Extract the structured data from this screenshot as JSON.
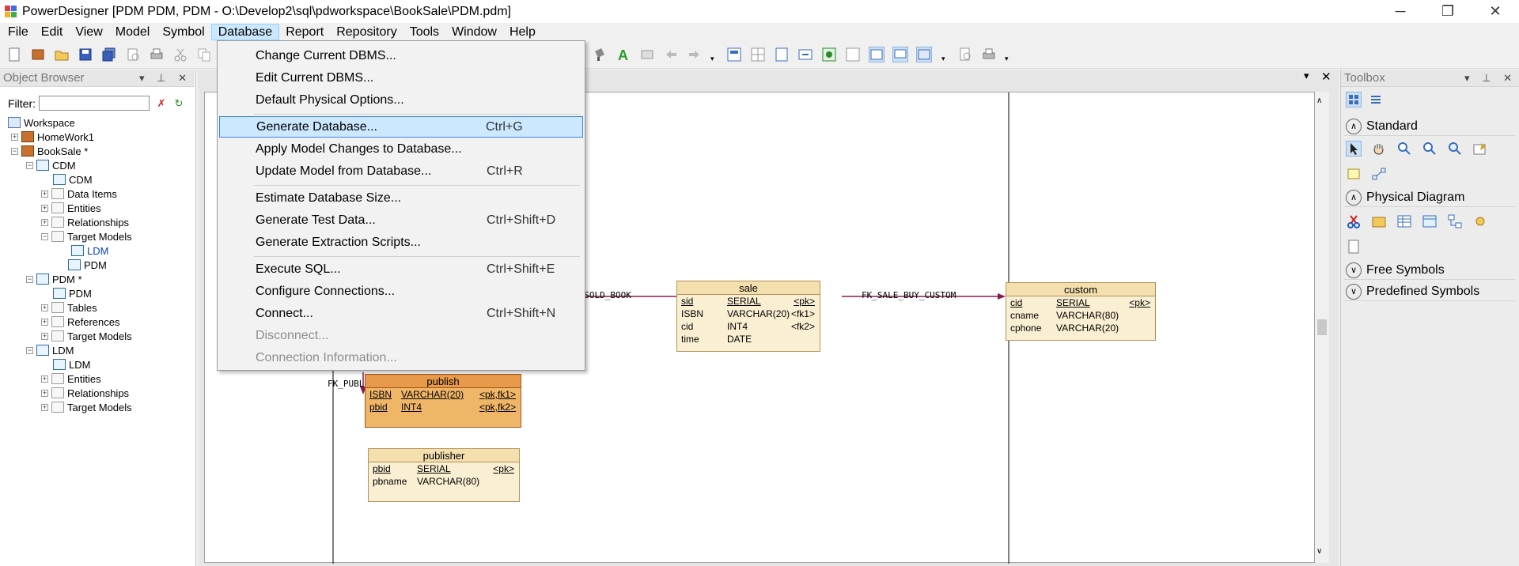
{
  "window": {
    "title": "PowerDesigner [PDM PDM, PDM - O:\\Develop2\\sql\\pdworkspace\\BookSale\\PDM.pdm]",
    "minimize": "─",
    "maximize": "❐",
    "close": "✕"
  },
  "menubar": [
    "File",
    "Edit",
    "View",
    "Model",
    "Symbol",
    "Database",
    "Report",
    "Repository",
    "Tools",
    "Window",
    "Help"
  ],
  "object_browser": {
    "title": "Object Browser",
    "filter_label": "Filter:",
    "filter_value": "",
    "tree": [
      {
        "label": "Workspace",
        "icon": "workspace-icon"
      },
      {
        "label": "HomeWork1",
        "icon": "model-icon"
      },
      {
        "label": "BookSale *",
        "icon": "model-icon"
      },
      {
        "label": "CDM",
        "icon": "model-icon"
      },
      {
        "label": "CDM",
        "icon": "diagram-icon"
      },
      {
        "label": "Data Items",
        "icon": "folder-icon"
      },
      {
        "label": "Entities",
        "icon": "folder-icon"
      },
      {
        "label": "Relationships",
        "icon": "folder-icon"
      },
      {
        "label": "Target Models",
        "icon": "folder-icon"
      },
      {
        "label": "LDM",
        "icon": "shortcut-icon"
      },
      {
        "label": "PDM",
        "icon": "shortcut-icon"
      },
      {
        "label": "PDM *",
        "icon": "model-icon"
      },
      {
        "label": "PDM",
        "icon": "diagram-icon"
      },
      {
        "label": "Tables",
        "icon": "folder-icon"
      },
      {
        "label": "References",
        "icon": "folder-icon"
      },
      {
        "label": "Target Models",
        "icon": "folder-icon"
      },
      {
        "label": "LDM",
        "icon": "model-icon"
      },
      {
        "label": "LDM",
        "icon": "diagram-icon"
      },
      {
        "label": "Entities",
        "icon": "folder-icon"
      },
      {
        "label": "Relationships",
        "icon": "folder-icon"
      },
      {
        "label": "Target Models",
        "icon": "folder-icon"
      }
    ]
  },
  "diagram": {
    "close_button": "✕",
    "menu_button": "▾",
    "entities": [
      {
        "name": "sale",
        "columns": [
          {
            "name": "sid",
            "type": "SERIAL",
            "key": "<pk>",
            "underline": true
          },
          {
            "name": "ISBN",
            "type": "VARCHAR(20)",
            "key": "<fk1>",
            "underline": false
          },
          {
            "name": "cid",
            "type": "INT4",
            "key": "<fk2>",
            "underline": false
          },
          {
            "name": "time",
            "type": "DATE",
            "key": "",
            "underline": false
          }
        ]
      },
      {
        "name": "custom",
        "columns": [
          {
            "name": "cid",
            "type": "SERIAL",
            "key": "<pk>",
            "underline": true
          },
          {
            "name": "cname",
            "type": "VARCHAR(80)",
            "key": "",
            "underline": false
          },
          {
            "name": "cphone",
            "type": "VARCHAR(20)",
            "key": "",
            "underline": false
          }
        ]
      },
      {
        "name": "publish",
        "columns": [
          {
            "name": "ISBN",
            "type": "VARCHAR(20)",
            "key": "<pk,fk1>",
            "underline": true
          },
          {
            "name": "pbid",
            "type": "INT4",
            "key": "<pk,fk2>",
            "underline": true
          }
        ]
      },
      {
        "name": "publisher",
        "columns": [
          {
            "name": "pbid",
            "type": "SERIAL",
            "key": "<pk>",
            "underline": true
          },
          {
            "name": "pbname",
            "type": "VARCHAR(80)",
            "key": "",
            "underline": false
          }
        ]
      }
    ],
    "relations": [
      "E_SOLD_BOOK",
      "FK_SALE_BUY_CUSTOM",
      "FK_PUBLISH_PUBLISH2_PUBLISHE"
    ]
  },
  "toolbox": {
    "title": "Toolbox",
    "sections": [
      {
        "label": "Standard",
        "state": "expanded"
      },
      {
        "label": "Physical Diagram",
        "state": "expanded"
      },
      {
        "label": "Free Symbols",
        "state": "collapsed"
      },
      {
        "label": "Predefined Symbols",
        "state": "collapsed"
      }
    ]
  },
  "database_menu": {
    "items": [
      {
        "label": "Change Current DBMS...",
        "shortcut": "",
        "state": "normal"
      },
      {
        "label": "Edit Current DBMS...",
        "shortcut": "",
        "state": "normal"
      },
      {
        "label": "Default Physical Options...",
        "shortcut": "",
        "state": "normal"
      },
      {
        "label": "Generate Database...",
        "shortcut": "Ctrl+G",
        "state": "highlighted"
      },
      {
        "label": "Apply Model Changes to Database...",
        "shortcut": "",
        "state": "normal"
      },
      {
        "label": "Update Model from Database...",
        "shortcut": "Ctrl+R",
        "state": "normal"
      },
      {
        "label": "Estimate Database Size...",
        "shortcut": "",
        "state": "normal"
      },
      {
        "label": "Generate Test Data...",
        "shortcut": "Ctrl+Shift+D",
        "state": "normal"
      },
      {
        "label": "Generate Extraction Scripts...",
        "shortcut": "",
        "state": "normal"
      },
      {
        "label": "Execute SQL...",
        "shortcut": "Ctrl+Shift+E",
        "state": "normal"
      },
      {
        "label": "Configure Connections...",
        "shortcut": "",
        "state": "normal"
      },
      {
        "label": "Connect...",
        "shortcut": "Ctrl+Shift+N",
        "state": "normal"
      },
      {
        "label": "Disconnect...",
        "shortcut": "",
        "state": "disabled"
      },
      {
        "label": "Connection Information...",
        "shortcut": "",
        "state": "disabled"
      }
    ]
  },
  "colors": {
    "menu_highlight": "#cce8ff",
    "menu_highlight_border": "#3c84d6",
    "entity_fill": "#faefd2",
    "entity_selected_fill": "#f0b668",
    "relation_line": "#8b1a4a"
  }
}
